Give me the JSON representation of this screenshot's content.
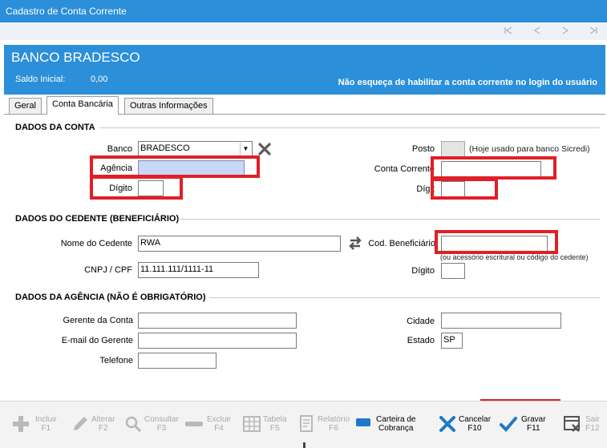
{
  "window": {
    "title": "Cadastro de Conta Corrente",
    "nav_icons": [
      "first-icon",
      "previous-icon",
      "next-icon",
      "last-icon"
    ]
  },
  "header": {
    "bank_name": "BANCO BRADESCO",
    "saldo_label": "Saldo Inicial:",
    "saldo_value": "0,00",
    "warning": "Não esqueça de habilitar a conta corrente no login do usuário"
  },
  "tabs": [
    {
      "label": "Geral"
    },
    {
      "label": "Conta Bancária"
    },
    {
      "label": "Outras Informações"
    }
  ],
  "dados_conta": {
    "title": "DADOS DA CONTA",
    "banco_label": "Banco",
    "banco_value": "BRADESCO",
    "agencia_label": "Agência",
    "agencia_value": "",
    "digito_label": "Dígito",
    "digito_value": "",
    "posto_label": "Posto",
    "posto_hint": "(Hoje usado para banco Sicredi)",
    "conta_label": "Conta Corrente",
    "conta_value": "",
    "conta_digito_label": "Dígit",
    "conta_digito_value": ""
  },
  "dados_cedente": {
    "title": "DADOS DO CEDENTE (BENEFICIÁRIO)",
    "nome_label": "Nome do Cedente",
    "nome_value": "RWA",
    "cnpj_label": "CNPJ / CPF",
    "cnpj_value": "11.111.111/1111-11",
    "cod_label": "Cod. Beneficiário",
    "cod_value": "",
    "cod_hint": "(ou acessório escritural ou código do cedente)",
    "digito_label": "Dígito",
    "digito_value": ""
  },
  "dados_agencia": {
    "title": "DADOS DA AGÊNCIA (NÃO É OBRIGATÓRIO)",
    "gerente_label": "Gerente da Conta",
    "gerente_value": "",
    "email_label": "E-mail do Gerente",
    "email_value": "",
    "telefone_label": "Telefone",
    "telefone_value": "",
    "cidade_label": "Cidade",
    "cidade_value": "",
    "estado_label": "Estado",
    "estado_value": "SP"
  },
  "toolbar": {
    "incluir_label": "Incluir",
    "incluir_key": "F1",
    "alterar_label": "Alterar",
    "alterar_key": "F2",
    "consultar_label": "Consultar",
    "consultar_key": "F3",
    "excluir_label": "Excluir",
    "excluir_key": "F4",
    "tabela_label": "Tabela",
    "tabela_key": "F5",
    "relatorio_label": "Relatório",
    "relatorio_key": "F6",
    "carteira_label": "Carteira de",
    "carteira_label2": "Cobrança",
    "cancelar_label": "Cancelar",
    "cancelar_key": "F10",
    "gravar_label": "Gravar",
    "gravar_key": "F11",
    "sair_label": "Sair",
    "sair_key": "F12"
  },
  "colors": {
    "accent_blue": "#2b8fd9",
    "highlight_red": "#e01f26",
    "focused_field": "#c8d7f4"
  }
}
